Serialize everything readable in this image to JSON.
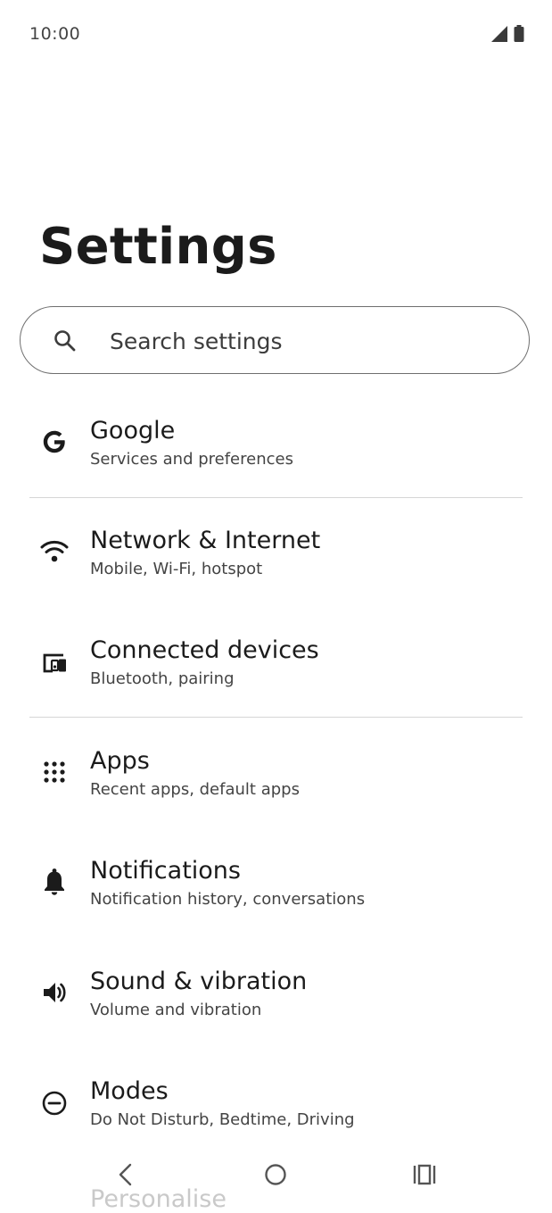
{
  "status_bar": {
    "time": "10:00",
    "icons": [
      "signal-icon",
      "battery-icon"
    ]
  },
  "page": {
    "title": "Settings"
  },
  "search": {
    "placeholder": "Search settings",
    "icon": "search-icon"
  },
  "items": [
    {
      "title": "Google",
      "subtitle": "Services and preferences",
      "icon": "google-icon"
    },
    {
      "title": "Network & Internet",
      "subtitle": "Mobile, Wi-Fi, hotspot",
      "icon": "wifi-icon"
    },
    {
      "title": "Connected devices",
      "subtitle": "Bluetooth, pairing",
      "icon": "connected-devices-icon"
    },
    {
      "title": "Apps",
      "subtitle": "Recent apps, default apps",
      "icon": "apps-grid-icon"
    },
    {
      "title": "Notifications",
      "subtitle": "Notification history, conversations",
      "icon": "bell-icon"
    },
    {
      "title": "Sound & vibration",
      "subtitle": "Volume and vibration",
      "icon": "speaker-icon"
    },
    {
      "title": "Modes",
      "subtitle": "Do Not Disturb, Bedtime, Driving",
      "icon": "do-not-disturb-icon"
    }
  ],
  "peek_item": {
    "title": "Personalise"
  },
  "nav_bar": {
    "icons": [
      "back-icon",
      "home-icon",
      "recents-icon"
    ]
  },
  "colors": {
    "text": "#1b1b1b",
    "subtext": "#444444",
    "divider": "#d6d6d6",
    "search_border": "#6f6f6f"
  }
}
